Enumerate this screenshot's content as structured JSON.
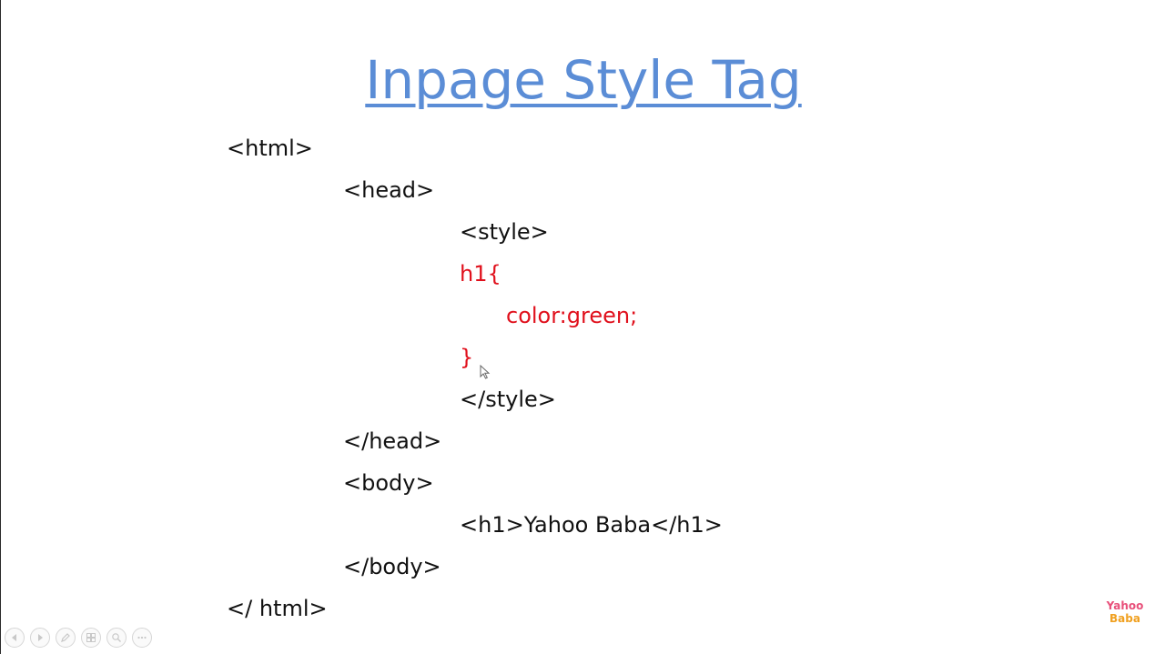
{
  "slide": {
    "title": "Inpage Style Tag",
    "code_lines": [
      "<html>",
      "<head>",
      "<style>",
      "h1{",
      "color:green;",
      "}",
      "</style>",
      "</head>",
      "<body>",
      "<h1>Yahoo Baba</h1>",
      "</body>",
      "</ html>"
    ]
  },
  "logo": {
    "line1": "Yahoo",
    "line2": "Baba"
  },
  "colors": {
    "title": "#5b8dd6",
    "code": "#111111",
    "css_code": "#e0101c",
    "logo_top": "#e8507a",
    "logo_bottom": "#f0a020"
  },
  "controls": {
    "icons": [
      "previous-icon",
      "next-icon",
      "pen-icon",
      "slides-icon",
      "zoom-icon",
      "more-icon"
    ]
  }
}
